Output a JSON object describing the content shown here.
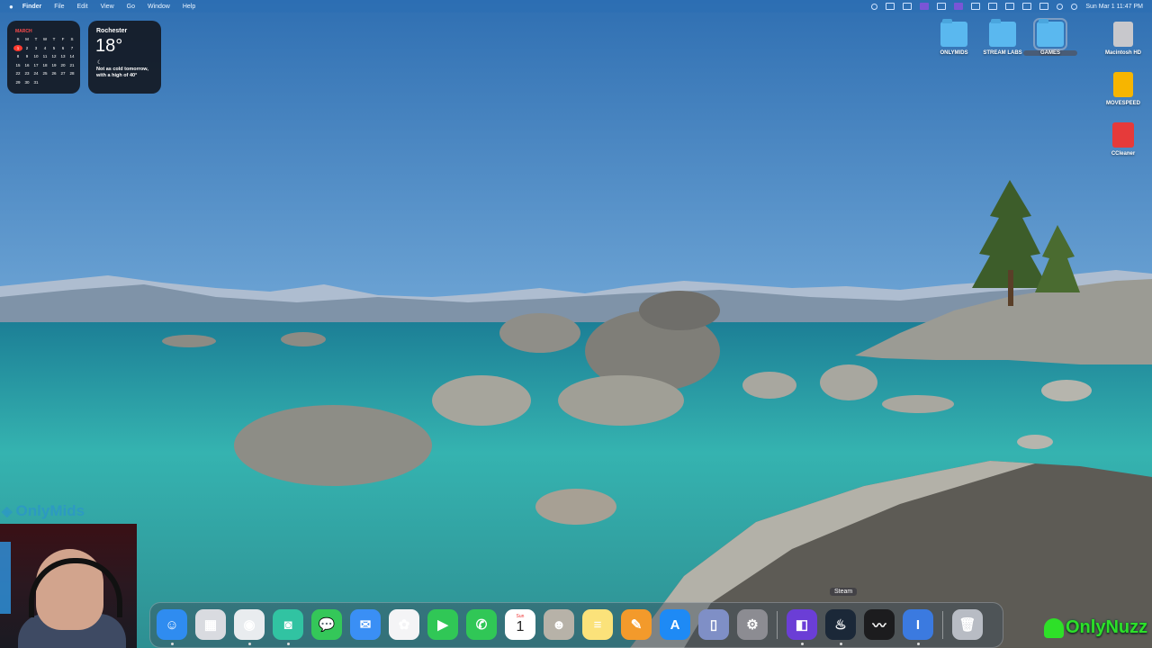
{
  "menubar": {
    "apple_glyph": "",
    "app_name": "Finder",
    "items": [
      "File",
      "Edit",
      "View",
      "Go",
      "Window",
      "Help"
    ],
    "clock": "Sun Mar 1  11:47 PM"
  },
  "calendar_widget": {
    "month": "MARCH",
    "weekdays": [
      "S",
      "M",
      "T",
      "W",
      "T",
      "F",
      "S"
    ],
    "days": [
      "1",
      "2",
      "3",
      "4",
      "5",
      "6",
      "7",
      "8",
      "9",
      "10",
      "11",
      "12",
      "13",
      "14",
      "15",
      "16",
      "17",
      "18",
      "19",
      "20",
      "21",
      "22",
      "23",
      "24",
      "25",
      "26",
      "27",
      "28",
      "29",
      "30",
      "31"
    ],
    "today": "1"
  },
  "weather_widget": {
    "city": "Rochester",
    "temperature": "18°",
    "forecast": "Not as cold tomorrow, with a high of 40°"
  },
  "desktop_icons": [
    {
      "label": "ONLYMIDS",
      "kind": "folder"
    },
    {
      "label": "STREAM LABS",
      "kind": "folder"
    },
    {
      "label": "GAMES",
      "kind": "folder",
      "selected": true
    },
    {
      "label": "Macintosh HD",
      "kind": "disk"
    },
    {
      "label": "MOVESPEED",
      "kind": "drive"
    },
    {
      "label": "CCleaner",
      "kind": "app"
    }
  ],
  "overlay": {
    "brand_text": "OnlyMids",
    "watermark_text": "OnlyNuzz"
  },
  "dock": {
    "tooltip": "Steam",
    "apps": [
      {
        "name": "Finder",
        "icon": "finder-icon",
        "glyph": "☺",
        "color": "#2f8cf0",
        "running": true
      },
      {
        "name": "Launchpad",
        "icon": "launchpad-icon",
        "glyph": "▦",
        "color": "#d9dbe0",
        "running": false
      },
      {
        "name": "Google Chrome",
        "icon": "chrome-icon",
        "glyph": "◉",
        "color": "#e9ecef",
        "running": true
      },
      {
        "name": "Streamlabs",
        "icon": "streamlabs-icon",
        "glyph": "◙",
        "color": "#31c3a2",
        "running": true
      },
      {
        "name": "Messages",
        "icon": "messages-icon",
        "glyph": "💬",
        "color": "#34c759",
        "running": false
      },
      {
        "name": "Mail",
        "icon": "mail-icon",
        "glyph": "✉",
        "color": "#3a8ff5",
        "running": false
      },
      {
        "name": "Photos",
        "icon": "photos-icon",
        "glyph": "✿",
        "color": "#f4f4f6",
        "running": false
      },
      {
        "name": "FaceTime",
        "icon": "facetime-icon",
        "glyph": "▶",
        "color": "#30c756",
        "running": false
      },
      {
        "name": "Phone",
        "icon": "phone-icon",
        "glyph": "✆",
        "color": "#30c756",
        "running": false
      },
      {
        "name": "Calendar",
        "icon": "calendar-icon",
        "glyph": "1",
        "sub": "Sun",
        "color": "#ffffff",
        "running": false
      },
      {
        "name": "Contacts",
        "icon": "contacts-icon",
        "glyph": "☻",
        "color": "#b7b2a8",
        "running": false
      },
      {
        "name": "Notes",
        "icon": "notes-icon",
        "glyph": "≡",
        "color": "#fbe27a",
        "running": false
      },
      {
        "name": "Pages",
        "icon": "pages-icon",
        "glyph": "✎",
        "color": "#f39a2b",
        "running": false
      },
      {
        "name": "App Store",
        "icon": "appstore-icon",
        "glyph": "A",
        "color": "#1e8af5",
        "running": false
      },
      {
        "name": "iPhone Mirroring",
        "icon": "iphone-mirroring-icon",
        "glyph": "▯",
        "color": "#7f8fc6",
        "running": false
      },
      {
        "name": "System Settings",
        "icon": "settings-icon",
        "glyph": "⚙",
        "color": "#8c8c92",
        "running": false
      },
      {
        "name": "Remote Desktop",
        "icon": "remote-icon",
        "glyph": "◧",
        "color": "#6b3ed6",
        "running": true
      },
      {
        "name": "Steam",
        "icon": "steam-icon",
        "glyph": "♨",
        "color": "#1b2838",
        "running": true
      },
      {
        "name": "Activity Monitor",
        "icon": "activity-monitor-icon",
        "glyph": "〰",
        "color": "#1c1c1e",
        "running": false
      },
      {
        "name": "Keynote",
        "icon": "keynote-icon",
        "glyph": "I",
        "color": "#3b7ae0",
        "running": true
      },
      {
        "name": "Trash",
        "icon": "trash-icon",
        "glyph": "🗑",
        "color": "#b8bcc4",
        "running": false
      }
    ]
  }
}
